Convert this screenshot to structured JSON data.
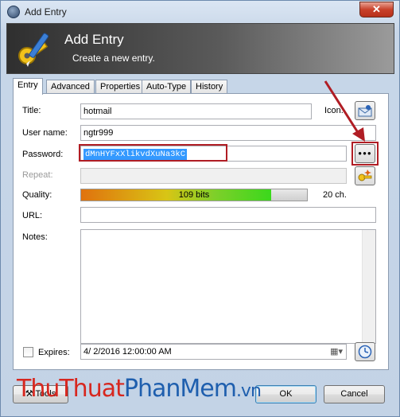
{
  "window": {
    "title": "Add Entry",
    "close_glyph": "✕"
  },
  "banner": {
    "title": "Add Entry",
    "subtitle": "Create a new entry."
  },
  "tabs": [
    {
      "label": "Entry",
      "active": true
    },
    {
      "label": "Advanced"
    },
    {
      "label": "Properties"
    },
    {
      "label": "Auto-Type"
    },
    {
      "label": "History"
    }
  ],
  "entry": {
    "title_label": "Title:",
    "title_value": "hotmail",
    "icon_label": "Icon:",
    "username_label": "User name:",
    "username_value": "ngtr999",
    "password_label": "Password:",
    "password_value": "dMnHYFxXlikvdXuNa3kC",
    "show_password_label": "●●●",
    "repeat_label": "Repeat:",
    "quality_label": "Quality:",
    "quality_text": "109 bits",
    "quality_fraction": 0.842,
    "char_count": "20 ch.",
    "url_label": "URL:",
    "url_value": "",
    "notes_label": "Notes:",
    "notes_value": "",
    "expires_label": "Expires:",
    "expires_value": "4/  2/2016 12:00:00 AM",
    "expires_checked": false
  },
  "footer": {
    "tools_label": "Tools",
    "ok_label": "OK",
    "cancel_label": "Cancel"
  },
  "watermark": {
    "part1": "ThuThuat",
    "part2": "PhanMem",
    "part3": ".vn"
  },
  "colors": {
    "highlight": "#b01d24",
    "selection": "#3399ff"
  }
}
